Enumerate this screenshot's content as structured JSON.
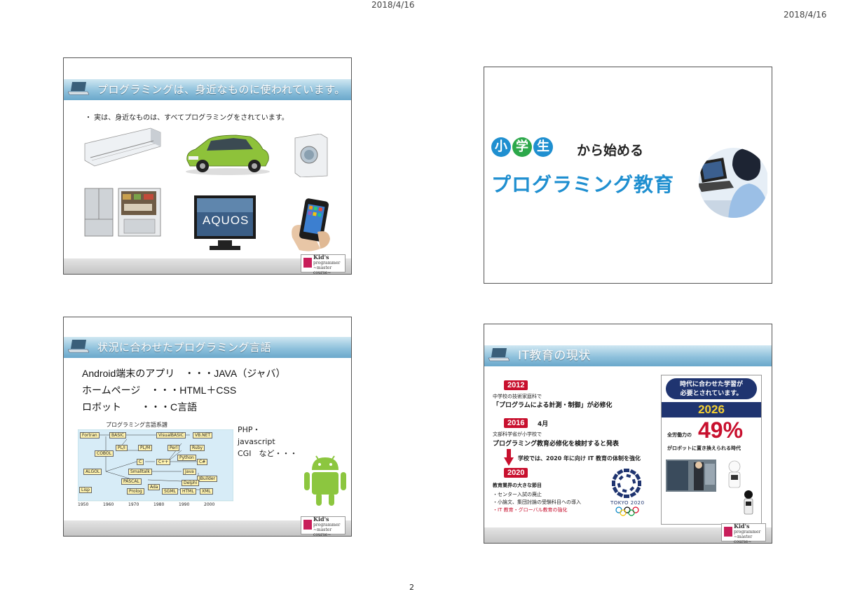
{
  "header": {
    "date_left": "2018/4/16",
    "date_right": "2018/4/16"
  },
  "page_number": "2",
  "logo": {
    "line1": "Kid's",
    "line2": "programmer",
    "line3": "~master course~"
  },
  "slide1": {
    "title": "プログラミングは、身近なものに使われています。",
    "bullet": "・ 実は、身近なものは、すべてプログラミングをされています。",
    "tv_brand": "AQUOS",
    "images": [
      "air-conditioner",
      "car",
      "washing-machine",
      "refrigerator",
      "television",
      "smartphone"
    ]
  },
  "slide2": {
    "badge": [
      "小",
      "学",
      "生"
    ],
    "title_part1": "から始める",
    "title_part2": "プログラミング教育"
  },
  "slide3": {
    "title": "状況に合わせたプログラミング言語",
    "lines": [
      "Android端末のアプリ　・・・JAVA（ジャバ）",
      "ホームページ　・・・HTML＋CSS",
      "ロボット　　・・・C言語"
    ],
    "side_text": [
      "PHP・",
      "javascript",
      "CGI　など・・・"
    ],
    "diagram": {
      "title": "プログラミング言語系譜",
      "languages": [
        "Fortran",
        "BASIC",
        "VisualBASIC",
        "VB.NET",
        "COBOL",
        "PL/I",
        "PL/M",
        "Perl",
        "Ruby",
        "Python",
        "ALGOL",
        "C",
        "C++",
        "C#",
        "Smalltalk",
        "Java",
        "JBuilder",
        "PASCAL",
        "Delphi",
        "Lisp",
        "Prolog",
        "Ada",
        "SGML",
        "HTML",
        "XML"
      ],
      "axis": [
        "1950",
        "1960",
        "1970",
        "1980",
        "1990",
        "2000"
      ]
    }
  },
  "slide4": {
    "title": "IT教育の現状",
    "y2012": "2012",
    "t2012_small": "中学校の技術家庭科で",
    "t2012_main": "「プログラムによる計測・制御」が必修化",
    "y2016": "2016",
    "y2016_month": "4月",
    "t2016_small": "文部科学省が小学校で",
    "t2016_main": "プログラミング教育必修化を検討すると発表",
    "t2016_note": "学校では、2020 年に向け IT 教育の体制を強化",
    "y2020": "2020",
    "t2020_head": "教育業界の大きな節目",
    "t2020_items": [
      "・センター入試の廃止",
      "・小論文、集団討論の受験科目への導入",
      "・IT 教育・グローバル教育の強化"
    ],
    "olympic": "TOKYO 2020",
    "box_header": "時代に合わせた学習が\n必要とされています。",
    "box_year": "2026",
    "box_percent": "49%",
    "box_caption_pre": "全労働力の",
    "box_caption": "がロボットに置き換えられる時代"
  },
  "colors": {
    "accent_blue": "#1f8fd0",
    "badge_green": "#2ca84a",
    "badge_blue": "#1f8fd0",
    "red": "#c8102e",
    "navy": "#1f3470"
  }
}
